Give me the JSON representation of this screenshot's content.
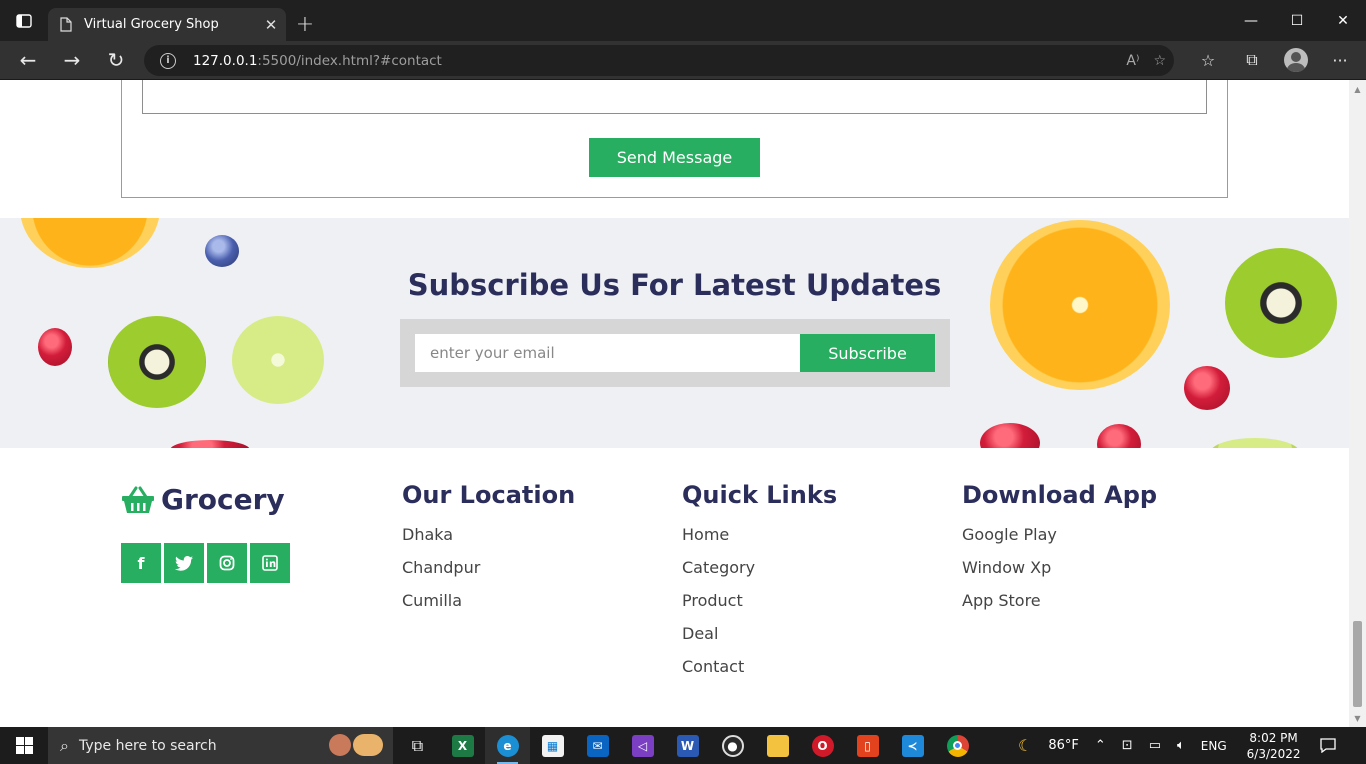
{
  "browser": {
    "tab_title": "Virtual Grocery Shop",
    "url_host": "127.0.0.1",
    "url_rest": ":5500/index.html?#contact"
  },
  "contact": {
    "send_label": "Send Message"
  },
  "newsletter": {
    "title": "Subscribe Us For Latest Updates",
    "email_placeholder": "enter your email",
    "subscribe_label": "Subscribe"
  },
  "footer": {
    "brand": "Grocery",
    "socials": [
      "facebook-icon",
      "twitter-icon",
      "instagram-icon",
      "linkedin-icon"
    ],
    "location": {
      "title": "Our Location",
      "items": [
        "Dhaka",
        "Chandpur",
        "Cumilla"
      ]
    },
    "quick_links": {
      "title": "Quick Links",
      "items": [
        "Home",
        "Category",
        "Product",
        "Deal",
        "Contact"
      ]
    },
    "download": {
      "title": "Download App",
      "items": [
        "Google Play",
        "Window Xp",
        "App Store"
      ]
    }
  },
  "taskbar": {
    "search_placeholder": "Type here to search",
    "weather": "86°F",
    "language": "ENG",
    "time": "8:02 PM",
    "date": "6/3/2022"
  },
  "colors": {
    "accent": "#27ae60",
    "heading": "#2b2d5a"
  }
}
